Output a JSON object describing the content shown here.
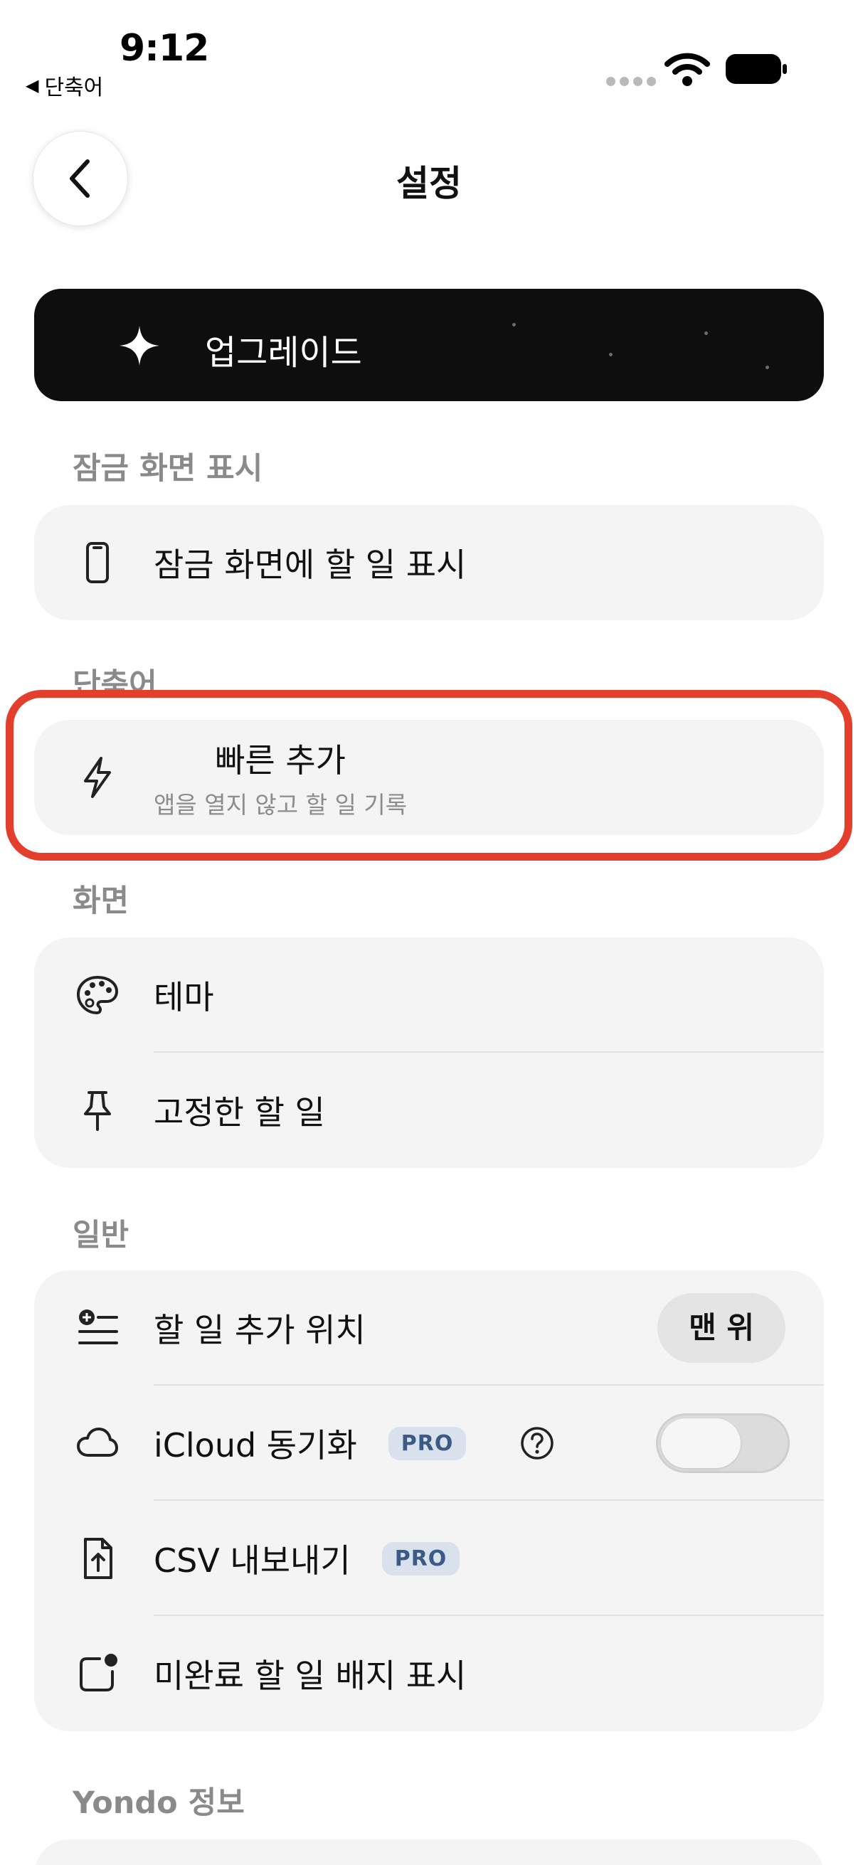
{
  "status_bar": {
    "time": "9:12",
    "back_app_label": "단축어"
  },
  "nav": {
    "title": "설정"
  },
  "upgrade": {
    "label": "업그레이드"
  },
  "sections": {
    "lock_screen": {
      "title": "잠금 화면 표시",
      "items": [
        {
          "label": "잠금 화면에 할 일 표시",
          "icon": "phone-icon"
        }
      ]
    },
    "shortcuts": {
      "title": "단축어",
      "items": [
        {
          "label": "빠른 추가",
          "subtitle": "앱을 열지 않고 할 일 기록",
          "icon": "bolt-icon"
        }
      ]
    },
    "display": {
      "title": "화면",
      "items": [
        {
          "label": "테마",
          "icon": "palette-icon"
        },
        {
          "label": "고정한 할 일",
          "icon": "pin-icon"
        }
      ]
    },
    "general": {
      "title": "일반",
      "items": [
        {
          "label": "할 일 추가 위치",
          "icon": "list-add-icon",
          "value": "맨 위"
        },
        {
          "label": "iCloud 동기화",
          "icon": "cloud-icon",
          "badge": "PRO",
          "toggle_on": false
        },
        {
          "label": "CSV 내보내기",
          "icon": "file-export-icon",
          "badge": "PRO"
        },
        {
          "label": "미완료 할 일 배지 표시",
          "icon": "badge-icon"
        }
      ]
    },
    "about": {
      "title": "Yondo 정보"
    }
  },
  "colors": {
    "upgrade_bg": "#0e0e0e",
    "card_bg": "#f4f4f4",
    "section_title": "#8a8a8a",
    "pro_badge_bg": "#d9e1ec",
    "pro_badge_text": "#3c5a86",
    "highlight": "#e43f2c"
  }
}
